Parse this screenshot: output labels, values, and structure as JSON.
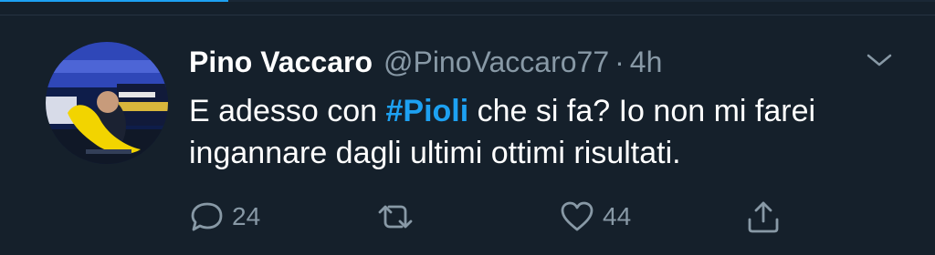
{
  "tweet": {
    "display_name": "Pino Vaccaro",
    "handle": "@PinoVaccaro77",
    "separator": "·",
    "time": "4h",
    "text_before": "E adesso con ",
    "hashtag": "#Pioli",
    "text_after": " che si fa? Io non mi farei ingannare dagli ultimi ottimi risultati."
  },
  "actions": {
    "reply_count": "24",
    "retweet_count": "",
    "like_count": "44"
  },
  "colors": {
    "background": "#15202b",
    "accent": "#1da1f2",
    "muted": "#8899a6",
    "text": "#ffffff"
  },
  "icons": {
    "reply": "speech-bubble-icon",
    "retweet": "retweet-arrows-icon",
    "like": "heart-icon",
    "share": "share-up-arrow-icon",
    "menu": "chevron-down-icon"
  }
}
